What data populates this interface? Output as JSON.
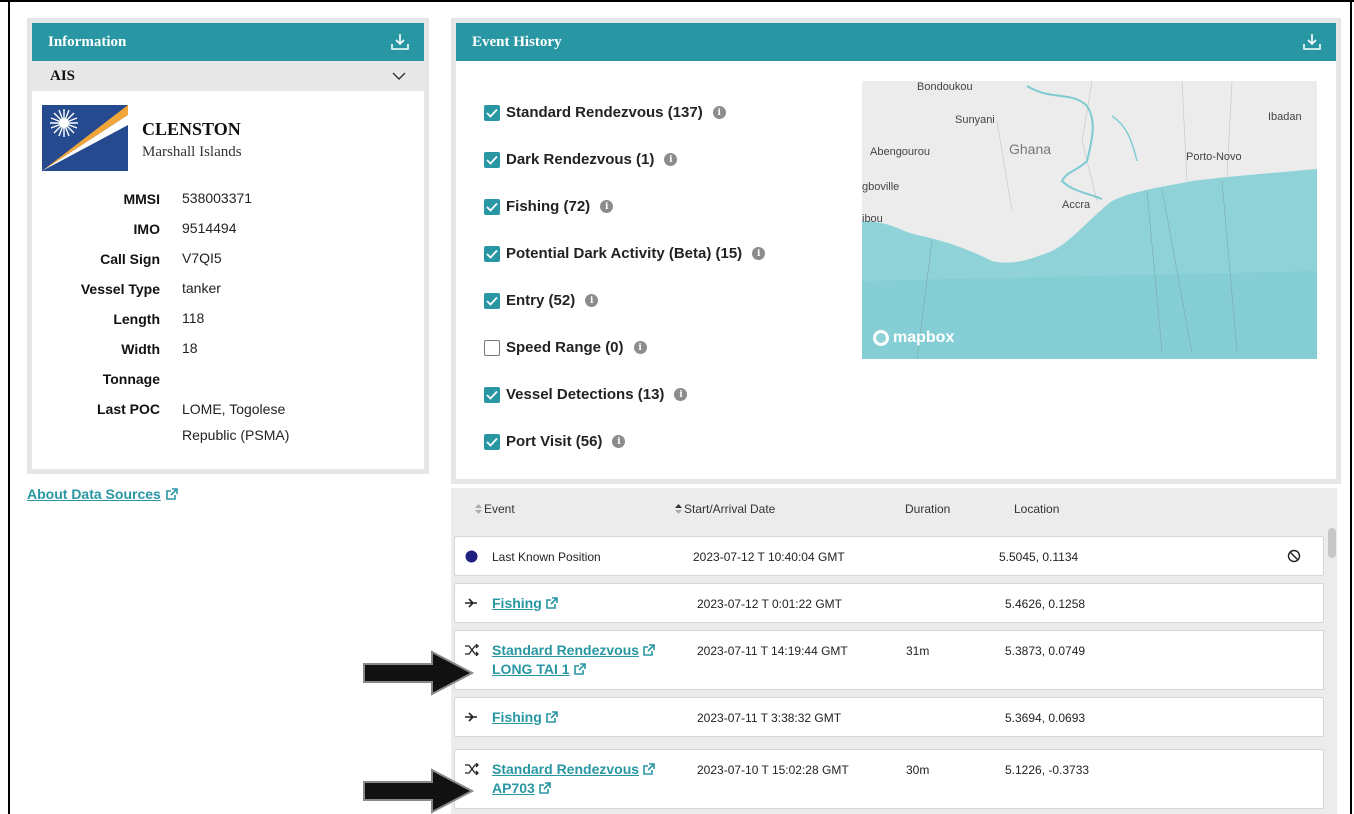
{
  "info_panel": {
    "title": "Information",
    "section": "AIS",
    "vessel_name": "CLENSTON",
    "vessel_country": "Marshall Islands",
    "fields": [
      {
        "label": "MMSI",
        "value": "538003371"
      },
      {
        "label": "IMO",
        "value": "9514494"
      },
      {
        "label": "Call Sign",
        "value": "V7QI5"
      },
      {
        "label": "Vessel Type",
        "value": "tanker"
      },
      {
        "label": "Length",
        "value": "118"
      },
      {
        "label": "Width",
        "value": "18"
      },
      {
        "label": "Tonnage",
        "value": ""
      },
      {
        "label": "Last POC",
        "value": "LOME, Togolese Republic (PSMA)"
      }
    ]
  },
  "about_link": "About Data Sources",
  "event_history": {
    "title": "Event History",
    "filters": [
      {
        "label": "Standard Rendezvous (137)",
        "checked": true
      },
      {
        "label": "Dark Rendezvous (1)",
        "checked": true
      },
      {
        "label": "Fishing (72)",
        "checked": true
      },
      {
        "label": "Potential Dark Activity (Beta) (15)",
        "checked": true
      },
      {
        "label": "Entry (52)",
        "checked": true
      },
      {
        "label": "Speed Range (0)",
        "checked": false
      },
      {
        "label": "Vessel Detections (13)",
        "checked": true
      },
      {
        "label": "Port Visit (56)",
        "checked": true
      }
    ],
    "map": {
      "labels": [
        "Bondoukou",
        "Sunyani",
        "Abengourou",
        "Ghana",
        "Porto-Novo",
        "Ibadan",
        "gboville",
        "ibou",
        "Accra"
      ],
      "attribution": "mapbox"
    }
  },
  "table": {
    "headers": [
      "Event",
      "Start/Arrival Date",
      "Duration",
      "Location"
    ],
    "rows": [
      {
        "event": "Last Known Position",
        "vessel": "",
        "date": "2023-07-12 T 10:40:04 GMT",
        "duration": "",
        "location": "5.5045, 0.1134",
        "icon": "dot-icon"
      },
      {
        "event": "Fishing",
        "vessel": "",
        "date": "2023-07-12 T 0:01:22 GMT",
        "duration": "",
        "location": "5.4626, 0.1258",
        "icon": "fishing-icon"
      },
      {
        "event": "Standard Rendezvous",
        "vessel": "LONG TAI 1",
        "date": "2023-07-11 T 14:19:44 GMT",
        "duration": "31m",
        "location": "5.3873, 0.0749",
        "icon": "shuffle-icon"
      },
      {
        "event": "Fishing",
        "vessel": "",
        "date": "2023-07-11 T 3:38:32 GMT",
        "duration": "",
        "location": "5.3694, 0.0693",
        "icon": "fishing-icon"
      },
      {
        "event": "Standard Rendezvous",
        "vessel": "AP703",
        "date": "2023-07-10 T 15:02:28 GMT",
        "duration": "30m",
        "location": "5.1226, -0.3733",
        "icon": "shuffle-icon"
      }
    ]
  },
  "colors": {
    "accent": "#2897a3",
    "header_text": "#ffffff",
    "panel_border": "#e6e6e6"
  }
}
